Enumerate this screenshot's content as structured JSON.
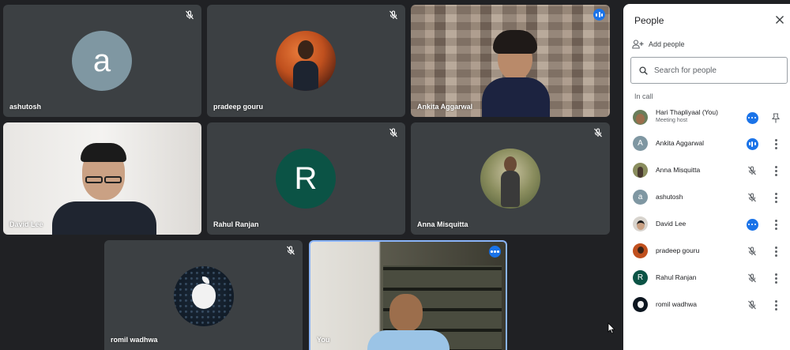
{
  "tiles": {
    "ashutosh": {
      "name": "ashutosh",
      "avatar_letter": "a",
      "avatar_color": "#7f97a2",
      "muted": true
    },
    "pradeep": {
      "name": "pradeep gouru",
      "muted": true
    },
    "ankita": {
      "name": "Ankita Aggarwal",
      "speaking": true
    },
    "david": {
      "name": "David Lee"
    },
    "rahul": {
      "name": "Rahul Ranjan",
      "avatar_letter": "R",
      "avatar_color": "#0b5345",
      "muted": true
    },
    "anna": {
      "name": "Anna Misquitta",
      "muted": true
    },
    "romil": {
      "name": "romil wadhwa",
      "muted": true
    },
    "you": {
      "name": "You",
      "has_options": true,
      "highlight_color": "#8ab4f8"
    }
  },
  "panel": {
    "title": "People",
    "add_people_label": "Add people",
    "search_placeholder": "Search for people",
    "section_label": "In call",
    "participants": [
      {
        "name": "Hari Thapliyaal (You)",
        "subtitle": "Meeting host",
        "avatar": "photo",
        "status": "options",
        "action": "pin-icon"
      },
      {
        "name": "Ankita Aggarwal",
        "avatar_letter": "A",
        "avatar_color": "#7f97a2",
        "status": "speaking",
        "action": "more-vert-icon"
      },
      {
        "name": "Anna Misquitta",
        "avatar": "photo",
        "status": "muted",
        "action": "more-vert-icon"
      },
      {
        "name": "ashutosh",
        "avatar_letter": "a",
        "avatar_color": "#7f97a2",
        "status": "muted",
        "action": "more-vert-icon"
      },
      {
        "name": "David Lee",
        "avatar": "photo",
        "status": "options",
        "action": "more-vert-icon"
      },
      {
        "name": "pradeep gouru",
        "avatar": "photo",
        "status": "muted",
        "action": "more-vert-icon"
      },
      {
        "name": "Rahul Ranjan",
        "avatar_letter": "R",
        "avatar_color": "#0b5345",
        "status": "muted",
        "action": "more-vert-icon"
      },
      {
        "name": "romil wadhwa",
        "avatar": "photo",
        "status": "muted",
        "action": "more-vert-icon"
      }
    ]
  },
  "colors": {
    "accent": "#1a73e8",
    "stage_bg": "#202124",
    "tile_bg": "#3c4043"
  }
}
